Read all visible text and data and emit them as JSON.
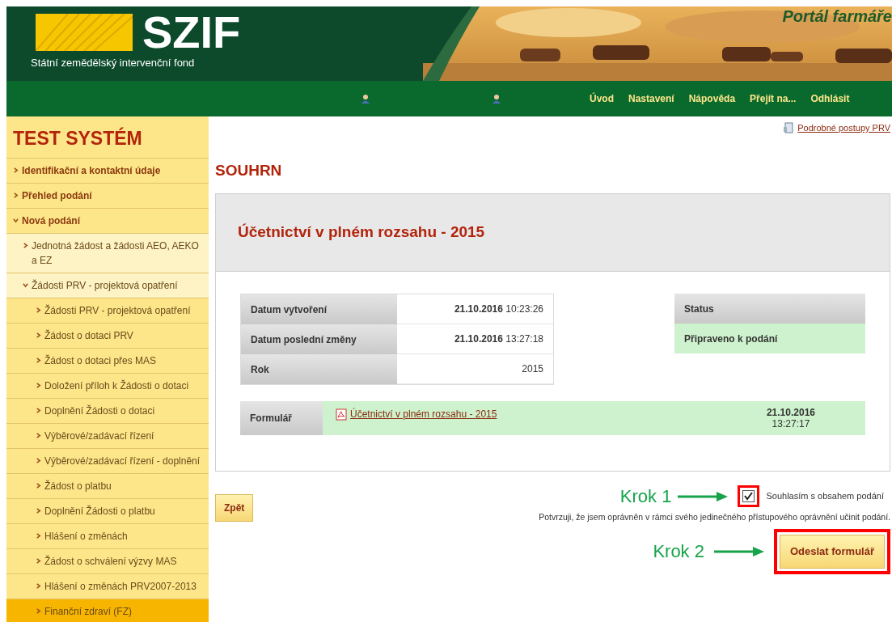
{
  "header": {
    "logo_text": "SZIF",
    "subtitle": "Státní zemědělský intervenční fond",
    "portal_title": "Portál farmáře"
  },
  "nav": {
    "items": [
      "Úvod",
      "Nastavení",
      "Nápověda",
      "Přejít na...",
      "Odhlásit"
    ]
  },
  "sidebar": {
    "title": "TEST SYSTÉM",
    "items": [
      {
        "label": "Identifikační a kontaktní údaje",
        "expanded": false,
        "selected": false
      },
      {
        "label": "Přehled podání",
        "expanded": false,
        "selected": false
      },
      {
        "label": "Nová podání",
        "expanded": true,
        "selected": false,
        "children": [
          {
            "label": "Jednotná žádost a žádosti AEO, AEKO a EZ",
            "expanded": false,
            "selected": false
          },
          {
            "label": "Žádosti PRV - projektová opatření",
            "expanded": true,
            "selected": false,
            "children": [
              {
                "label": "Žádosti PRV - projektová opatření",
                "selected": false
              },
              {
                "label": "Žádost o dotaci PRV",
                "selected": false
              },
              {
                "label": "Žádost o dotaci přes MAS",
                "selected": false
              },
              {
                "label": "Doložení příloh k Žádosti o dotaci",
                "selected": false
              },
              {
                "label": "Doplnění Žádosti o dotaci",
                "selected": false
              },
              {
                "label": "Výběrové/zadávací řízení",
                "selected": false
              },
              {
                "label": "Výběrové/zadávací řízení - doplnění",
                "selected": false
              },
              {
                "label": "Žádost o platbu",
                "selected": false
              },
              {
                "label": "Doplnění Žádosti o platbu",
                "selected": false
              },
              {
                "label": "Hlášení o změnách",
                "selected": false
              },
              {
                "label": "Žádost o schválení výzvy MAS",
                "selected": false
              },
              {
                "label": "Hlášení o změnách PRV2007-2013",
                "selected": false
              },
              {
                "label": "Finanční zdraví (FZ)",
                "selected": true
              }
            ]
          }
        ]
      }
    ]
  },
  "help_link": "Podrobné postupy PRV",
  "heading": "SOUHRN",
  "panel": {
    "title": "Účetnictví v plném rozsahu - 2015",
    "info_rows": [
      {
        "label": "Datum vytvoření",
        "value": "**21.10.2016** 10:23:26"
      },
      {
        "label": "Datum poslední změny",
        "value": "**21.10.2016** 13:27:18"
      },
      {
        "label": "Rok",
        "value": "2015"
      }
    ],
    "status": {
      "label": "Status",
      "value": "Připraveno k podání"
    },
    "form": {
      "label": "Formulář",
      "link": "Účetnictví v plném rozsahu - 2015",
      "date": "21.10.2016",
      "time": "13:27:17"
    }
  },
  "back_button": "Zpět",
  "consent": {
    "label": "Souhlasím s obsahem podání",
    "checked": true,
    "note": "Potvrzuji, že jsem oprávněn v rámci svého jedinečného přístupového oprávnění učinit podání."
  },
  "steps": [
    "Krok 1",
    "Krok 2"
  ],
  "submit_button": "Odeslat formulář"
}
